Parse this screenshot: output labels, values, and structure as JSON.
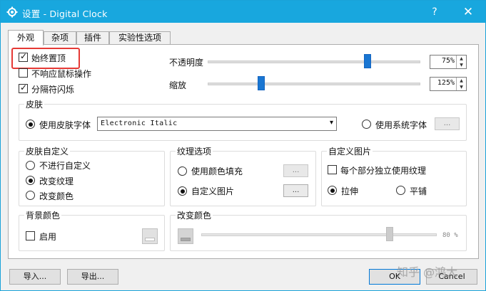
{
  "window": {
    "title": "设置 - Digital Clock",
    "help_label": "?",
    "close_label": "✕",
    "title_bar_color": "#18a7de"
  },
  "tabs": [
    {
      "label": "外观",
      "active": true
    },
    {
      "label": "杂项",
      "active": false
    },
    {
      "label": "插件",
      "active": false
    },
    {
      "label": "实验性选项",
      "active": false
    }
  ],
  "appearance": {
    "always_on_top": {
      "label": "始终置顶",
      "checked": true
    },
    "no_mouse": {
      "label": "不响应鼠标操作",
      "checked": false
    },
    "blink_separator": {
      "label": "分隔符闪烁",
      "checked": true
    },
    "opacity": {
      "label": "不透明度",
      "value": "75%",
      "level": 0.75
    },
    "zoom": {
      "label": "缩放",
      "value": "125%",
      "level": 0.25
    }
  },
  "skin": {
    "title": "皮肤",
    "use_skin_font": {
      "label": "使用皮肤字体",
      "selected": true
    },
    "font_value": "Electronic Italic",
    "use_system_font": {
      "label": "使用系统字体",
      "selected": false
    },
    "font_button": "..."
  },
  "skin_custom": {
    "title": "皮肤自定义",
    "options": [
      {
        "label": "不进行自定义",
        "selected": false
      },
      {
        "label": "改变纹理",
        "selected": true
      },
      {
        "label": "改变颜色",
        "selected": false
      }
    ]
  },
  "texture": {
    "title": "纹理选项",
    "fill_color": {
      "label": "使用颜色填充",
      "selected": false,
      "button": "..."
    },
    "custom_image": {
      "label": "自定义图片",
      "selected": true,
      "button": "..."
    }
  },
  "custom_image": {
    "title": "自定义图片",
    "per_part": {
      "label": "每个部分独立使用纹理",
      "checked": false
    },
    "stretch": {
      "label": "拉伸",
      "selected": true
    },
    "tile": {
      "label": "平铺",
      "selected": false
    }
  },
  "background": {
    "title": "背景颜色",
    "enable": {
      "label": "启用",
      "checked": false
    }
  },
  "change_color": {
    "title": "改变颜色",
    "value": "80 %",
    "level": 0.8
  },
  "footer": {
    "import_label": "导入...",
    "export_label": "导出...",
    "ok_label": "OK",
    "cancel_label": "Cancel"
  },
  "watermark": "知乎 @鸿大",
  "icons": {
    "check": "✓",
    "dropdown": "▾",
    "spin_up": "▲",
    "spin_down": "▼"
  },
  "colors": {
    "accent": "#18a7de",
    "slider_thumb": "#1976d2",
    "highlight": "#e53935"
  }
}
